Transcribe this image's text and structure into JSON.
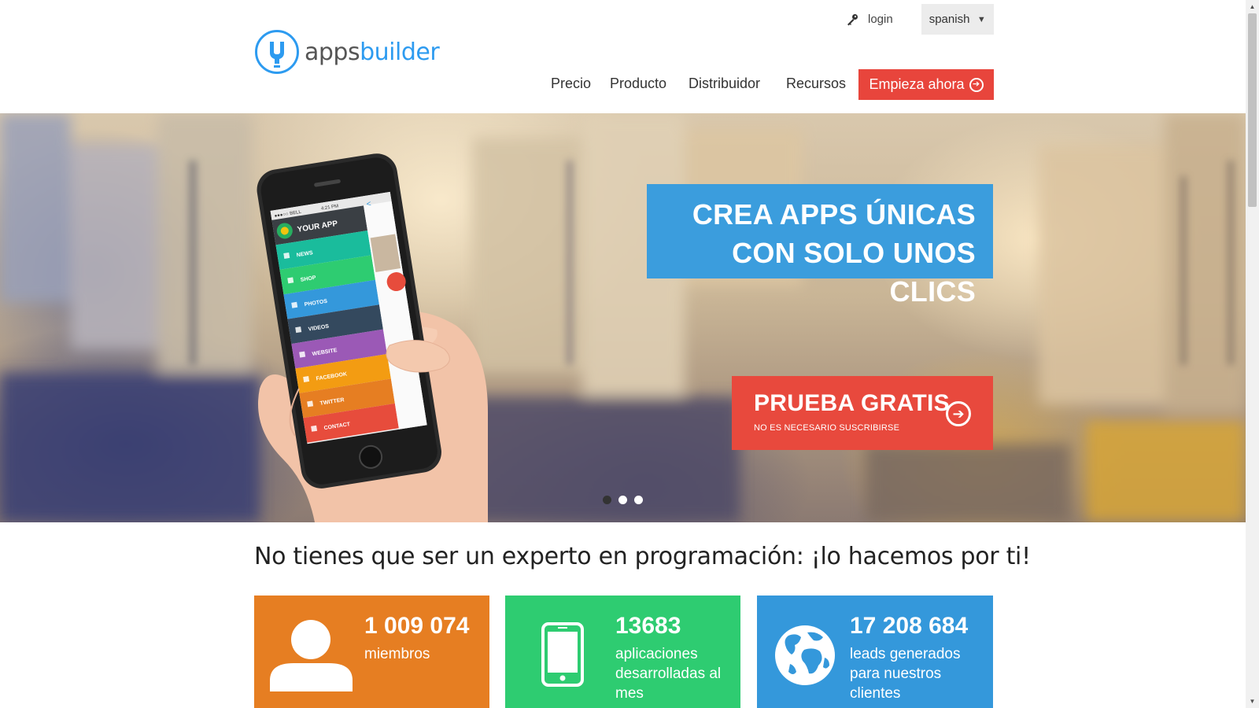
{
  "brand": {
    "name_part1": "apps",
    "name_part2": "builder",
    "accent": "#2d9bf0"
  },
  "topbar": {
    "login_label": "login",
    "login_icon": "key-icon",
    "language_value": "spanish"
  },
  "nav": {
    "items": [
      {
        "label": "Precio"
      },
      {
        "label": "Producto"
      },
      {
        "label": "Distribuidor"
      },
      {
        "label": "Recursos"
      }
    ],
    "cta_label": "Empieza ahora",
    "cta_color": "#e8453c"
  },
  "hero": {
    "title_line1": "CREA APPS ÚNICAS",
    "title_line2": "CON SOLO UNOS CLICS",
    "title_bg": "#3b9ddd",
    "cta_big": "PRUEBA GRATIS",
    "cta_small": "NO ES NECESARIO SUSCRIBIRSE",
    "cta_bg": "#e8493d",
    "slides": 3,
    "active_slide": 1,
    "phone": {
      "status_carrier": "●●●○○ BELL",
      "status_time": "4:21 PM",
      "app_title": "YOUR APP",
      "menu": [
        {
          "label": "NEWS",
          "color": "#1abc9c"
        },
        {
          "label": "SHOP",
          "color": "#2ecc71"
        },
        {
          "label": "PHOTOS",
          "color": "#3498db"
        },
        {
          "label": "VIDEOS",
          "color": "#34495e"
        },
        {
          "label": "WEBSITE",
          "color": "#9b59b6"
        },
        {
          "label": "FACEBOOK",
          "color": "#f39c12"
        },
        {
          "label": "TWITTER",
          "color": "#e67e22"
        },
        {
          "label": "CONTACT",
          "color": "#e74c3c"
        }
      ]
    }
  },
  "headline": "No tienes que ser un experto en programación: ¡lo hacemos por ti!",
  "stats": [
    {
      "number": "1 009 074",
      "label_lines": [
        "miembros"
      ],
      "icon": "user-icon",
      "color": "#e67e22"
    },
    {
      "number": "13683",
      "label_lines": [
        "aplicaciones",
        "desarrolladas al",
        "mes"
      ],
      "icon": "smartphone-icon",
      "color": "#2ecc71"
    },
    {
      "number": "17 208 684",
      "label_lines": [
        "leads generados",
        "para nuestros",
        "clientes"
      ],
      "icon": "globe-icon",
      "color": "#3498db"
    }
  ]
}
